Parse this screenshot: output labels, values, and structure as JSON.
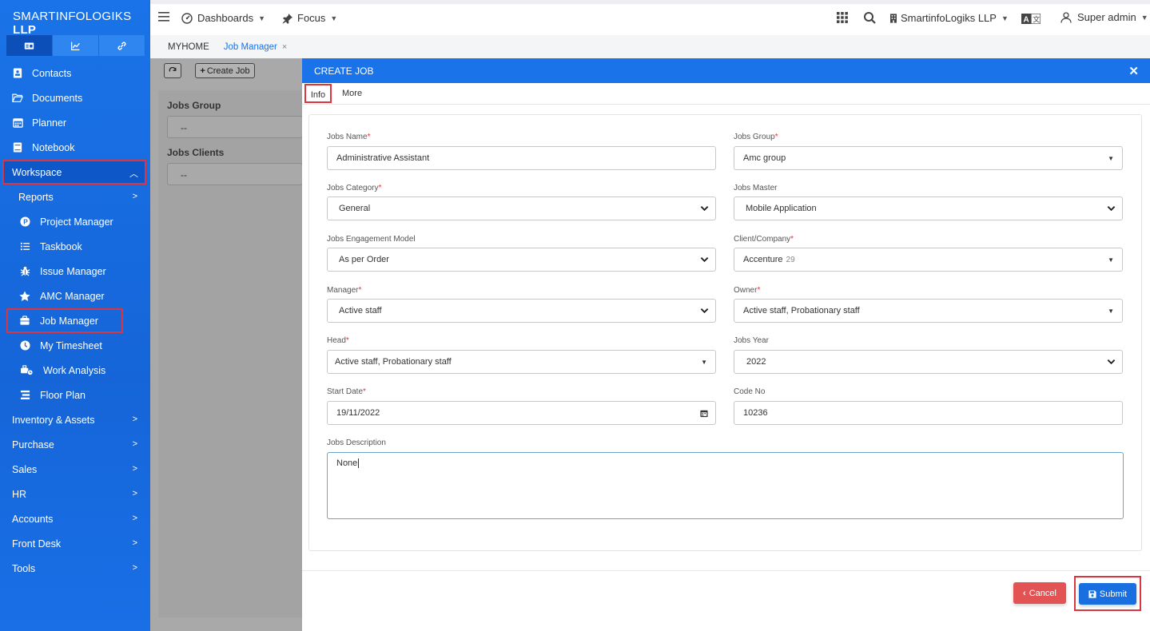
{
  "brand": {
    "name": "SMARTINFOLOGIKS",
    "suffix": "LLP"
  },
  "sidebar": {
    "items": [
      {
        "label": "Contacts",
        "icon": "contact-icon"
      },
      {
        "label": "Documents",
        "icon": "folder-open-icon"
      },
      {
        "label": "Planner",
        "icon": "calendar-icon"
      },
      {
        "label": "Notebook",
        "icon": "notebook-icon"
      },
      {
        "label": "Workspace",
        "icon": "chevron-up-icon"
      },
      {
        "label": "Reports",
        "icon": "chevron-right-icon"
      },
      {
        "label": "Project Manager",
        "icon": "p-circle-icon"
      },
      {
        "label": "Taskbook",
        "icon": "list-icon"
      },
      {
        "label": "Issue Manager",
        "icon": "bug-icon"
      },
      {
        "label": "AMC Manager",
        "icon": "star-icon"
      },
      {
        "label": "Job Manager",
        "icon": "briefcase-icon"
      },
      {
        "label": "My Timesheet",
        "icon": "clock-icon"
      },
      {
        "label": "Work Analysis",
        "icon": "truck-clock-icon"
      },
      {
        "label": "Floor Plan",
        "icon": "bars-icon"
      },
      {
        "label": "Inventory & Assets",
        "icon": "chevron-right-icon"
      },
      {
        "label": "Purchase",
        "icon": "chevron-right-icon"
      },
      {
        "label": "Sales",
        "icon": "chevron-right-icon"
      },
      {
        "label": "HR",
        "icon": "chevron-right-icon"
      },
      {
        "label": "Accounts",
        "icon": "chevron-right-icon"
      },
      {
        "label": "Front Desk",
        "icon": "chevron-right-icon"
      },
      {
        "label": "Tools",
        "icon": "chevron-right-icon"
      }
    ]
  },
  "topbar": {
    "dashboards": "Dashboards",
    "focus": "Focus",
    "company": "SmartinfoLogiks LLP",
    "user": "Super admin"
  },
  "tabs": {
    "home": "MYHOME",
    "active": "Job Manager",
    "close": "×"
  },
  "background": {
    "create_job": "Create Job",
    "jobs_group_label": "Jobs Group",
    "jobs_group_value": "--",
    "jobs_clients_label": "Jobs Clients",
    "jobs_clients_value": "--"
  },
  "modal": {
    "title": "CREATE JOB",
    "tabs": [
      "Info",
      "More"
    ],
    "fields": {
      "jobs_name": {
        "label": "Jobs Name",
        "value": "Administrative Assistant"
      },
      "jobs_group": {
        "label": "Jobs Group",
        "value": "Amc group"
      },
      "jobs_category": {
        "label": "Jobs Category",
        "value": "General"
      },
      "jobs_master": {
        "label": "Jobs Master",
        "value": "Mobile Application"
      },
      "engagement_model": {
        "label": "Jobs Engagement Model",
        "value": "As per Order"
      },
      "client_company": {
        "label": "Client/Company",
        "value": "Accenture",
        "count": "29"
      },
      "manager": {
        "label": "Manager",
        "value": "Active staff"
      },
      "owner": {
        "label": "Owner",
        "value": "Active staff, Probationary staff"
      },
      "head": {
        "label": "Head",
        "value": "Active staff, Probationary staff"
      },
      "jobs_year": {
        "label": "Jobs Year",
        "value": "2022"
      },
      "start_date": {
        "label": "Start Date",
        "value": "19/11/2022"
      },
      "code_no": {
        "label": "Code No",
        "value": "10236"
      },
      "description": {
        "label": "Jobs Description",
        "value": "None"
      }
    },
    "buttons": {
      "cancel": "Cancel",
      "submit": "Submit"
    }
  },
  "colors": {
    "primary": "#1a73e8",
    "danger": "#e45353",
    "highlight": "#d9363e"
  }
}
